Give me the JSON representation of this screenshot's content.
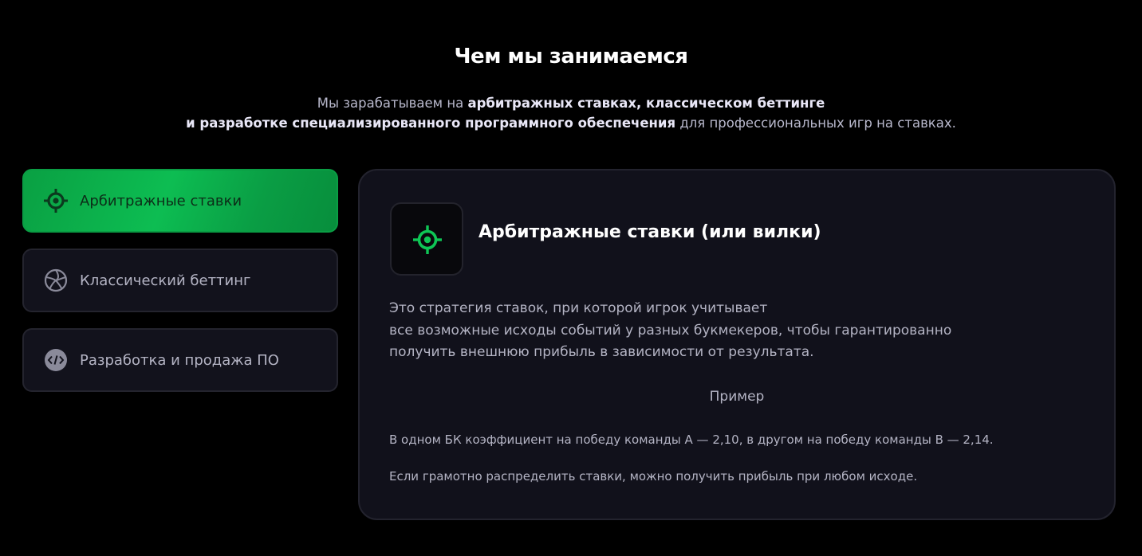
{
  "section": {
    "title": "Чем мы занимаемся",
    "subtitle": {
      "line1_prefix": "Мы зарабатываем на ",
      "line1_bold": "арбитражных ставках, классическом беттинге",
      "line2_bold": "и разработке специализированного программного обеспечения",
      "line2_suffix": " для профессиональных игр на ставках."
    }
  },
  "tabs": [
    {
      "label": "Арбитражные ставки",
      "icon": "target-icon",
      "active": true
    },
    {
      "label": "Классический беттинг",
      "icon": "aperture-icon",
      "active": false
    },
    {
      "label": "Разработка и продажа ПО",
      "icon": "code-icon",
      "active": false
    }
  ],
  "card": {
    "icon": "target-icon",
    "title": "Арбитражные ставки (или вилки)",
    "description": [
      "Это стратегия ставок, при которой игрок учитывает",
      "все возможные исходы событий у разных букмекеров, чтобы гарантированно",
      "получить внешнюю прибыль в зависимости от результата."
    ],
    "example_heading": "Пример",
    "example_lines": [
      "В одном БК коэффициент на победу команды А — 2,10, в другом на победу команды В — 2,14.",
      "Если грамотно распределить ставки, можно получить прибыль при любом исходе."
    ]
  },
  "colors": {
    "background": "#000000",
    "accent_green": "#0dbd52",
    "card_bg": "#11111b",
    "text_muted": "#b4b4c4"
  }
}
